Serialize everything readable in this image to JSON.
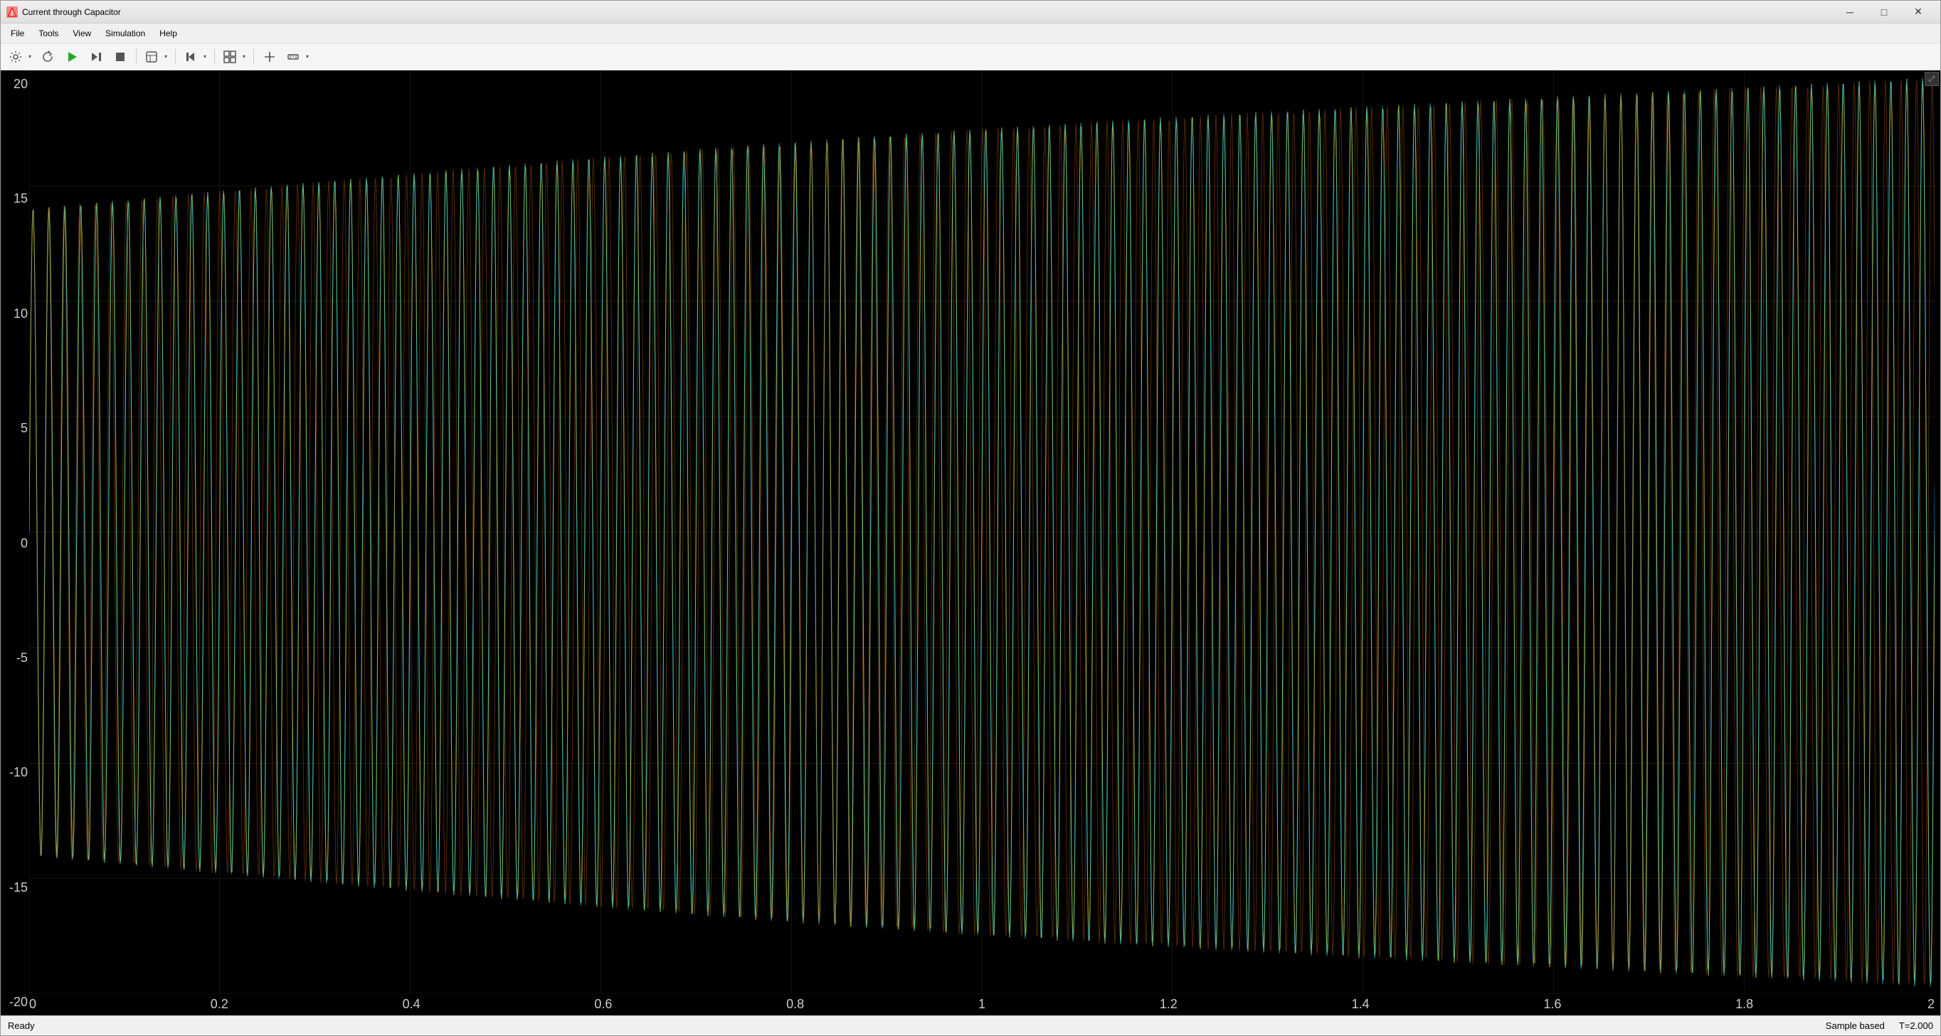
{
  "window": {
    "title": "Current through Capacitor",
    "icon": "🔶"
  },
  "menu": {
    "items": [
      "File",
      "Tools",
      "View",
      "Simulation",
      "Help"
    ]
  },
  "toolbar": {
    "buttons": [
      {
        "name": "settings-btn",
        "icon": "⚙",
        "has_arrow": true
      },
      {
        "name": "refresh-btn",
        "icon": "↺",
        "has_arrow": false
      },
      {
        "name": "run-btn",
        "icon": "▶",
        "has_arrow": false
      },
      {
        "name": "step-btn",
        "icon": "⏭",
        "has_arrow": false
      },
      {
        "name": "stop-btn",
        "icon": "⏹",
        "has_arrow": false
      },
      {
        "name": "config-btn",
        "icon": "⚙",
        "has_arrow": true
      },
      {
        "name": "prev-btn",
        "icon": "⏮",
        "has_arrow": true
      },
      {
        "name": "zoom-btn",
        "icon": "⊞",
        "has_arrow": true
      },
      {
        "name": "cursor-btn",
        "icon": "↕",
        "has_arrow": false
      },
      {
        "name": "measure-btn",
        "icon": "📏",
        "has_arrow": true
      }
    ]
  },
  "plot": {
    "title": "Current through Capacitor",
    "y_axis": {
      "labels": [
        "20",
        "15",
        "10",
        "5",
        "0",
        "-5",
        "-10",
        "-15",
        "-20"
      ],
      "min": -20,
      "max": 20
    },
    "x_axis": {
      "labels": [
        "0",
        "0.2",
        "0.4",
        "0.6",
        "0.8",
        "1",
        "1.2",
        "1.4",
        "1.6",
        "1.8",
        "2"
      ],
      "min": 0,
      "max": 2
    }
  },
  "status": {
    "left": "Ready",
    "right_sample": "Sample based",
    "right_time": "T=2.000"
  }
}
